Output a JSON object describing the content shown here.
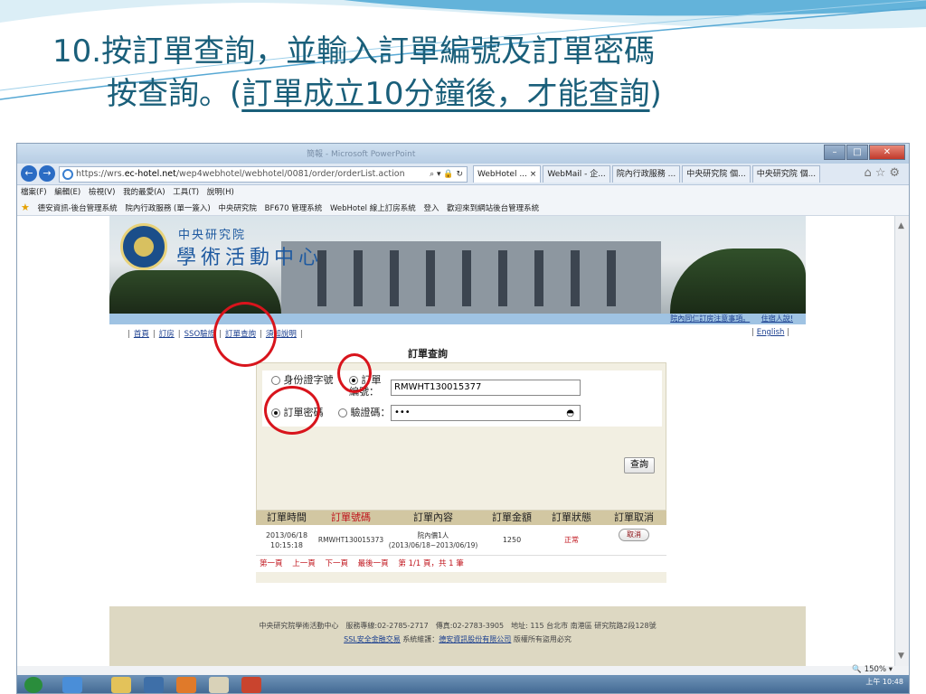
{
  "slide": {
    "title_line1": "10.按訂單查詢，並輸入訂單編號及訂單密碼",
    "title_line2_prefix": "按查詢。(",
    "title_line2_note": "訂單成立10分鐘後，才能查詢",
    "title_line2_suffix": ")"
  },
  "browser": {
    "window_title": "簡報 - Microsoft PowerPoint",
    "url_prefix": "https://wrs.",
    "url_host": "ec-hotel.net",
    "url_path": "/wep4webhotel/webhotel/0081/order/orderList.action",
    "addr_tools": "⌕ ▾ 🔒 ↻",
    "tabs": [
      "WebHotel ...",
      "WebMail - 企...",
      "院內行政服務 ...",
      "中央研究院 個...",
      "中央研究院 個..."
    ],
    "tab_close": "×",
    "menu": [
      "檔案(F)",
      "編輯(E)",
      "檢視(V)",
      "我的最愛(A)",
      "工具(T)",
      "說明(H)"
    ],
    "favorites": [
      "德安資訊-後台管理系統",
      "院內行政服務 (單一簽入)",
      "中央研究院",
      "BF670 管理系統",
      "WebHotel 線上訂房系統",
      "登入",
      "歡迎來到網站後台管理系統"
    ],
    "zoom": "150%",
    "clock": "上午 10:48"
  },
  "site": {
    "org_name": "中央研究院",
    "center_name": "學術活動中心",
    "links": [
      "院內同仁訂房注意事項。",
      "住宿人說!"
    ],
    "nav": [
      "首頁",
      "訂房",
      "SSO驗證",
      "訂單查詢",
      "須知說明"
    ],
    "english": "English"
  },
  "query": {
    "title": "訂單查詢",
    "opt_id": "身份證字號",
    "opt_order_no": "訂單編號：",
    "order_no_value": "RMWHT130015377",
    "opt_password": "訂單密碼",
    "opt_captcha": "驗證碼：",
    "password_value": "•••",
    "submit": "查詢"
  },
  "results": {
    "headers": [
      "訂單時間",
      "訂單號碼",
      "訂單內容",
      "訂單金額",
      "訂單狀態",
      "訂單取消"
    ],
    "row": {
      "date": "2013/06/18",
      "time": "10:15:18",
      "order_no": "RMWHT130015373",
      "content1": "院內價1人",
      "content2": "(2013/06/18~2013/06/19)",
      "amount": "1250",
      "status": "正常",
      "cancel": "取消"
    },
    "pager": [
      "第一頁",
      "上一頁",
      "下一頁",
      "最後一頁",
      "第 1/1 頁，共 1 筆"
    ]
  },
  "footer": {
    "line1": "中央研究院學術活動中心　服務專線:02-2785-2717　傳真:02-2783-3905　地址: 115 台北市 南港區 研究院路2段128號",
    "ssl": "SSL安全金融交易",
    "maint_label": "系統維護：",
    "maint": "德安資訊股份有限公司",
    "rights": "版權所有盜用必究"
  },
  "colors": {
    "title": "#1a5f7a",
    "annotation": "#d8141c",
    "table_header": "#d2c7a2"
  }
}
